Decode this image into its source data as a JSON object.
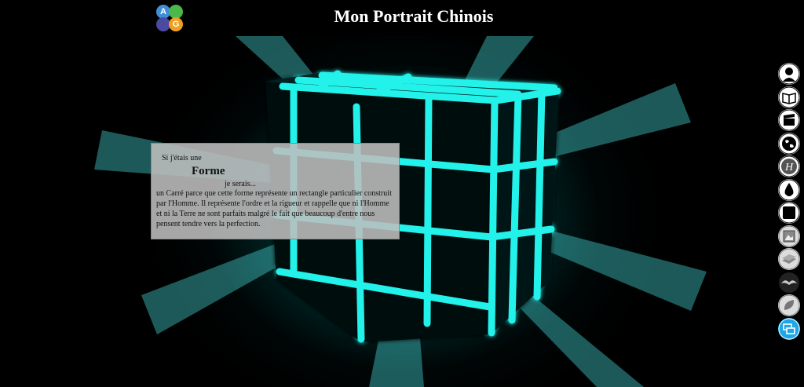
{
  "header": {
    "title": "Mon Portrait Chinois",
    "logo_letters": [
      "A",
      "G"
    ]
  },
  "panel": {
    "intro": "Si j'étais une",
    "word": "Forme",
    "serais": "je serais...",
    "description": "un Carré parce que cette forme représente un rectangle particulier construit par l'Homme. Il représente l'ordre et la rigueur et rappelle que ni l'Homme et ni la Terre ne sont parfaits malgré le fait que beaucoup d'entre nous pensent tendre vers la perfection."
  },
  "nav": {
    "items": [
      {
        "icon": "person-icon"
      },
      {
        "icon": "book-icon"
      },
      {
        "icon": "clapperboard-icon"
      },
      {
        "icon": "globe-icon"
      },
      {
        "icon": "h-letter-icon"
      },
      {
        "icon": "drop-icon"
      },
      {
        "icon": "square-icon"
      },
      {
        "icon": "painting-icon"
      },
      {
        "icon": "books-stack-icon"
      },
      {
        "icon": "mustache-icon"
      },
      {
        "icon": "leaf-icon"
      },
      {
        "icon": "chat-bubbles-icon"
      }
    ]
  },
  "colors": {
    "accent": "#1ea7e8",
    "glow": "#22f2ea",
    "panel": "#bebebe"
  }
}
